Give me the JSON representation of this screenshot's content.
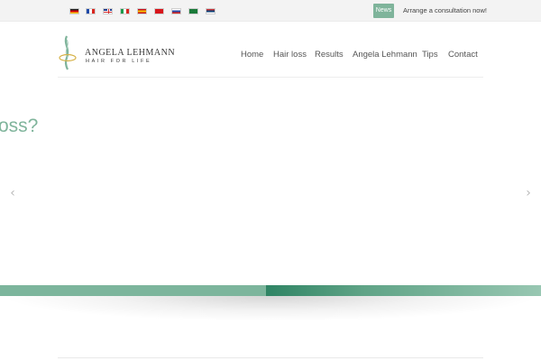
{
  "topbar": {
    "flags": [
      {
        "name": "flag-germany",
        "colors": [
          "#222222",
          "#d5000a",
          "#f9c80e"
        ],
        "dir": "h"
      },
      {
        "name": "flag-france",
        "colors": [
          "#1f4aa8",
          "#ffffff",
          "#d8261f"
        ],
        "dir": "v"
      },
      {
        "name": "flag-uk",
        "colors": [
          "#223f8f",
          "#ffffff",
          "#d22b2b"
        ],
        "dir": "uk"
      },
      {
        "name": "flag-italy",
        "colors": [
          "#1a9a4a",
          "#ffffff",
          "#d8261f"
        ],
        "dir": "v"
      },
      {
        "name": "flag-spain",
        "colors": [
          "#c8141e",
          "#f6c200",
          "#c8141e"
        ],
        "dir": "h"
      },
      {
        "name": "flag-turkey",
        "colors": [
          "#d8161c",
          "#d8161c",
          "#d8161c"
        ],
        "dir": "h"
      },
      {
        "name": "flag-russia",
        "colors": [
          "#ffffff",
          "#2748a6",
          "#d8261f"
        ],
        "dir": "h"
      },
      {
        "name": "flag-saudi-arabia",
        "colors": [
          "#1b7a3a",
          "#1b7a3a",
          "#1b7a3a"
        ],
        "dir": "h"
      },
      {
        "name": "flag-serbia",
        "colors": [
          "#c6363c",
          "#0c4076",
          "#ffffff"
        ],
        "dir": "h"
      }
    ],
    "news_label": "News",
    "consult_text": "Arrange a consultation now!"
  },
  "logo": {
    "name": "ANGELA LEHMANN",
    "tagline": "HAIR FOR LIFE",
    "colors": {
      "leaf": "#7fb49b",
      "swirl": "#d6b34a"
    }
  },
  "nav": {
    "items": [
      "Home",
      "Hair loss",
      "Results",
      "Angela Lehmann",
      "Tips",
      "Contact"
    ]
  },
  "slider": {
    "heading": "oss?",
    "prev_icon": "chevron-left-icon",
    "next_icon": "chevron-right-icon"
  },
  "colors": {
    "accent": "#7fb49b",
    "stripe_dark": "#2f8464"
  }
}
